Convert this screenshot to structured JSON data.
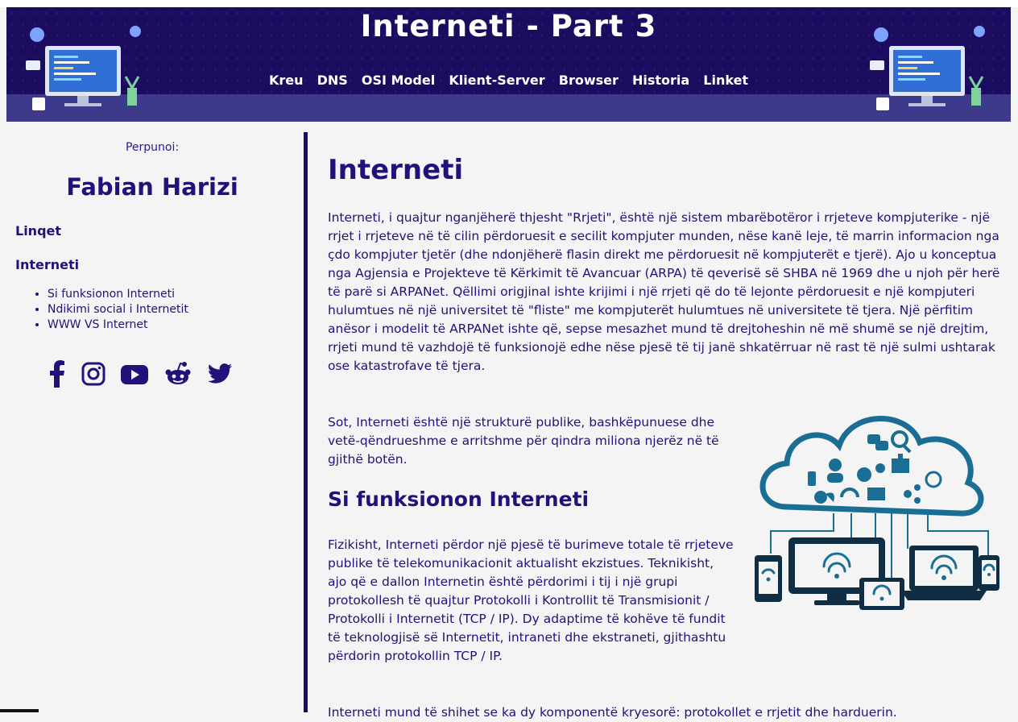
{
  "header": {
    "title": "Interneti - Part 3",
    "nav": [
      "Kreu",
      "DNS",
      "OSI Model",
      "Klient-Server",
      "Browser",
      "Historia",
      "Linket"
    ],
    "colors": {
      "background": "#1b0c5f",
      "band": "#3d3a8c",
      "text": "#ffffff"
    }
  },
  "sidebar": {
    "credit_label": "Perpunoi:",
    "author": "Fabian Harizi",
    "links_title": "Linqet",
    "section_title": "Interneti",
    "toc": [
      "Si funksionon Interneti",
      "Ndikimi social i Internetit",
      "WWW VS Internet"
    ],
    "socials": [
      "facebook-icon",
      "instagram-icon",
      "youtube-icon",
      "reddit-icon",
      "twitter-icon"
    ]
  },
  "main": {
    "title": "Interneti",
    "paragraph1": "Interneti, i quajtur nganjëherë thjesht \"Rrjeti\", është një sistem mbarëbotëror i rrjeteve kompjuterike - një rrjet i rrjeteve në të cilin përdoruesit e secilit kompjuter munden, nëse kanë leje, të marrin informacion nga çdo kompjuter tjetër (dhe ndonjëherë flasin direkt me përdoruesit në kompjuterët e tjerë). Ajo u konceptua nga Agjensia e Projekteve të Kërkimit të Avancuar (ARPA) të qeverisë së SHBA në 1969 dhe u njoh për herë të parë si ARPANet. Qëllimi origjinal ishte krijimi i një rrjeti që do të lejonte përdoruesit e një kompjuteri hulumtues në një universitet të \"fliste\" me kompjuterët hulumtues në universitete të tjera. Një përfitim anësor i modelit të ARPANet ishte që, sepse mesazhet mund të drejtoheshin në më shumë se një drejtim, rrjeti mund të vazhdojë të funksionojë edhe nëse pjesë të tij janë shkatërruar në rast të një sulmi ushtarak ose katastrofave të tjera.",
    "paragraph2": "Sot, Interneti është një strukturë publike, bashkëpunuese dhe vetë-qëndrueshme e arritshme për qindra miliona njerëz në të gjithë botën.",
    "subtitle": "Si funksionon Interneti",
    "paragraph3": "Fizikisht, Interneti përdor një pjesë të burimeve totale të rrjeteve publike të telekomunikacionit aktualisht ekzistues. Teknikisht, ajo që e dallon Internetin është përdorimi i tij i një grupi protokollesh të quajtur Protokolli i Kontrollit të Transmisionit / Protokolli i Internetit (TCP / IP). Dy adaptime të kohëve të fundit të teknologjisë së Internetit, intraneti dhe ekstraneti, gjithashtu përdorin protokollin TCP / IP.",
    "paragraph4": "Interneti mund të shihet se ka dy komponentë kryesorë: protokollet e rrjetit dhe harduerin."
  },
  "colors": {
    "accent": "#22117a",
    "page_bg": "#f4f4f4",
    "cloud": "#1a6e94",
    "device": "#0f2e44"
  }
}
